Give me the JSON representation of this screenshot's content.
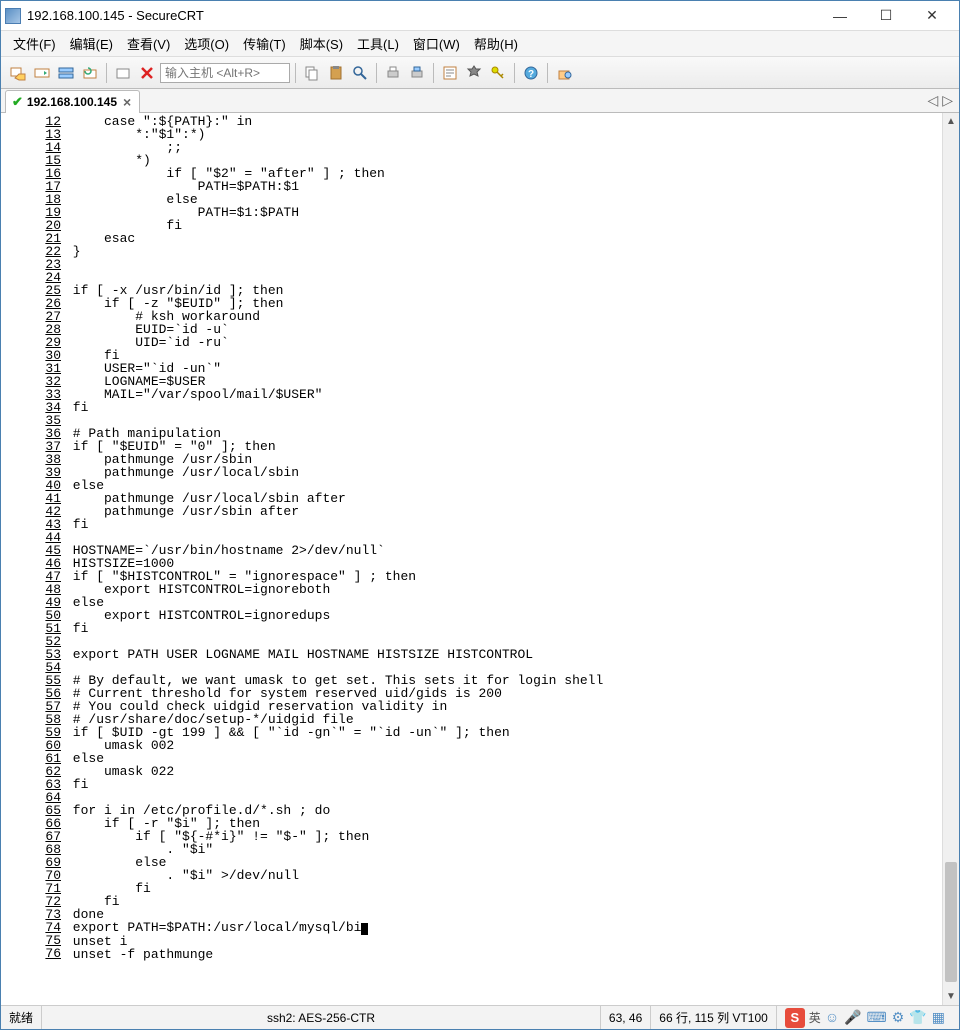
{
  "title": "192.168.100.145 - SecureCRT",
  "menu": [
    "文件(F)",
    "编辑(E)",
    "查看(V)",
    "选项(O)",
    "传输(T)",
    "脚本(S)",
    "工具(L)",
    "窗口(W)",
    "帮助(H)"
  ],
  "host_placeholder": "输入主机 <Alt+R>",
  "tab_label": "192.168.100.145",
  "lines": [
    {
      "n": "12",
      "t": "    case \":${PATH}:\" in"
    },
    {
      "n": "13",
      "t": "        *:\"$1\":*)"
    },
    {
      "n": "14",
      "t": "            ;;"
    },
    {
      "n": "15",
      "t": "        *)"
    },
    {
      "n": "16",
      "t": "            if [ \"$2\" = \"after\" ] ; then"
    },
    {
      "n": "17",
      "t": "                PATH=$PATH:$1"
    },
    {
      "n": "18",
      "t": "            else"
    },
    {
      "n": "19",
      "t": "                PATH=$1:$PATH"
    },
    {
      "n": "20",
      "t": "            fi"
    },
    {
      "n": "21",
      "t": "    esac"
    },
    {
      "n": "22",
      "t": "}"
    },
    {
      "n": "23",
      "t": ""
    },
    {
      "n": "24",
      "t": ""
    },
    {
      "n": "25",
      "t": "if [ -x /usr/bin/id ]; then"
    },
    {
      "n": "26",
      "t": "    if [ -z \"$EUID\" ]; then"
    },
    {
      "n": "27",
      "t": "        # ksh workaround"
    },
    {
      "n": "28",
      "t": "        EUID=`id -u`"
    },
    {
      "n": "29",
      "t": "        UID=`id -ru`"
    },
    {
      "n": "30",
      "t": "    fi"
    },
    {
      "n": "31",
      "t": "    USER=\"`id -un`\""
    },
    {
      "n": "32",
      "t": "    LOGNAME=$USER"
    },
    {
      "n": "33",
      "t": "    MAIL=\"/var/spool/mail/$USER\""
    },
    {
      "n": "34",
      "t": "fi"
    },
    {
      "n": "35",
      "t": ""
    },
    {
      "n": "36",
      "t": "# Path manipulation"
    },
    {
      "n": "37",
      "t": "if [ \"$EUID\" = \"0\" ]; then"
    },
    {
      "n": "38",
      "t": "    pathmunge /usr/sbin"
    },
    {
      "n": "39",
      "t": "    pathmunge /usr/local/sbin"
    },
    {
      "n": "40",
      "t": "else"
    },
    {
      "n": "41",
      "t": "    pathmunge /usr/local/sbin after"
    },
    {
      "n": "42",
      "t": "    pathmunge /usr/sbin after"
    },
    {
      "n": "43",
      "t": "fi"
    },
    {
      "n": "44",
      "t": ""
    },
    {
      "n": "45",
      "t": "HOSTNAME=`/usr/bin/hostname 2>/dev/null`"
    },
    {
      "n": "46",
      "t": "HISTSIZE=1000"
    },
    {
      "n": "47",
      "t": "if [ \"$HISTCONTROL\" = \"ignorespace\" ] ; then"
    },
    {
      "n": "48",
      "t": "    export HISTCONTROL=ignoreboth"
    },
    {
      "n": "49",
      "t": "else"
    },
    {
      "n": "50",
      "t": "    export HISTCONTROL=ignoredups"
    },
    {
      "n": "51",
      "t": "fi"
    },
    {
      "n": "52",
      "t": ""
    },
    {
      "n": "53",
      "t": "export PATH USER LOGNAME MAIL HOSTNAME HISTSIZE HISTCONTROL"
    },
    {
      "n": "54",
      "t": ""
    },
    {
      "n": "55",
      "t": "# By default, we want umask to get set. This sets it for login shell"
    },
    {
      "n": "56",
      "t": "# Current threshold for system reserved uid/gids is 200"
    },
    {
      "n": "57",
      "t": "# You could check uidgid reservation validity in"
    },
    {
      "n": "58",
      "t": "# /usr/share/doc/setup-*/uidgid file"
    },
    {
      "n": "59",
      "t": "if [ $UID -gt 199 ] && [ \"`id -gn`\" = \"`id -un`\" ]; then"
    },
    {
      "n": "60",
      "t": "    umask 002"
    },
    {
      "n": "61",
      "t": "else"
    },
    {
      "n": "62",
      "t": "    umask 022"
    },
    {
      "n": "63",
      "t": "fi"
    },
    {
      "n": "64",
      "t": ""
    },
    {
      "n": "65",
      "t": "for i in /etc/profile.d/*.sh ; do"
    },
    {
      "n": "66",
      "t": "    if [ -r \"$i\" ]; then"
    },
    {
      "n": "67",
      "t": "        if [ \"${-#*i}\" != \"$-\" ]; then"
    },
    {
      "n": "68",
      "t": "            . \"$i\""
    },
    {
      "n": "69",
      "t": "        else"
    },
    {
      "n": "70",
      "t": "            . \"$i\" >/dev/null"
    },
    {
      "n": "71",
      "t": "        fi"
    },
    {
      "n": "72",
      "t": "    fi"
    },
    {
      "n": "73",
      "t": "done"
    },
    {
      "n": "74",
      "t": "export PATH=$PATH:/usr/local/mysql/bi",
      "cursor": true,
      "after": ""
    },
    {
      "n": "75",
      "t": "unset i"
    },
    {
      "n": "76",
      "t": "unset -f pathmunge"
    }
  ],
  "status": {
    "ready": "就绪",
    "conn": "ssh2: AES-256-CTR",
    "pos": "63, 46",
    "size": "66 行, 115 列  VT100",
    "ime_letter": "S",
    "ime_lang": "英"
  }
}
